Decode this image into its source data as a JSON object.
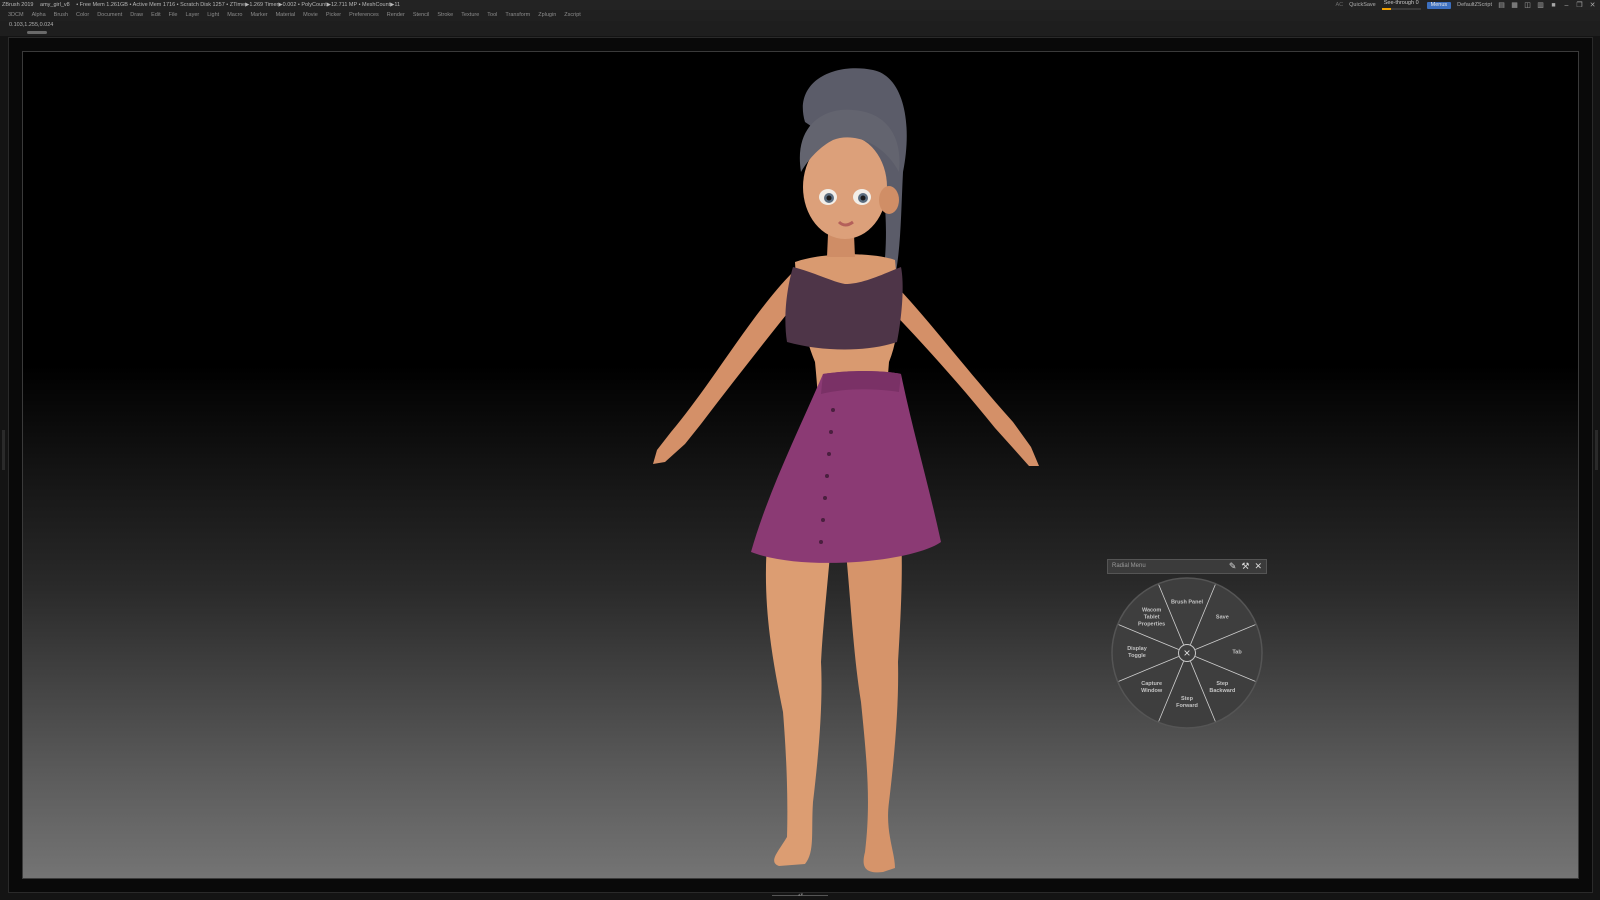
{
  "titlebar": {
    "app": "ZBrush 2019",
    "document": "amy_girl_v8",
    "stats": "• Free Mem 1.261GB • Active Mem 1716 • Scratch Disk 1257 •  ZTime▶1.269 Timer▶0.002 • PolyCount▶12.711 MP  • MeshCount▶11",
    "ac": "AC",
    "quicksave": "QuickSave",
    "see_through_label": "See-through",
    "see_through_value": "0",
    "see_through_fill": 0.25,
    "menus_button": "Menus",
    "script": "DefaultZScript",
    "icons": [
      "layout-icon",
      "layout2-icon",
      "dock-icon",
      "tray-icon",
      "lock-icon",
      "minimize-icon",
      "restore-icon",
      "close-icon"
    ]
  },
  "menubar": {
    "items": [
      "3DCM",
      "Alpha",
      "Brush",
      "Color",
      "Document",
      "Draw",
      "Edit",
      "File",
      "Layer",
      "Light",
      "Macro",
      "Marker",
      "Material",
      "Movie",
      "Picker",
      "Preferences",
      "Render",
      "Stencil",
      "Stroke",
      "Texture",
      "Tool",
      "Transform",
      "Zplugin",
      "Zscript"
    ]
  },
  "info": {
    "coords": "0.103,1.255,0.024"
  },
  "radial": {
    "title": "Radial Menu",
    "items": [
      {
        "label": "Brush Panel"
      },
      {
        "label": "Save"
      },
      {
        "label": "Tab"
      },
      {
        "label": "Step\nBackward"
      },
      {
        "label": "Step\nForward"
      },
      {
        "label": "Capture\nWindow"
      },
      {
        "label": "Display\nToggle"
      },
      {
        "label": "Wacom\nTablet\nProperties"
      }
    ]
  },
  "colors": {
    "background": "#141414",
    "viewport_top": "#000000",
    "viewport_bottom": "#747474",
    "accent": "#3c6fbf",
    "slider": "#f0a000",
    "skirt": "#8b3a74",
    "top": "#4e3548",
    "skin": "#d99a70",
    "hair": "#5b5c69"
  }
}
